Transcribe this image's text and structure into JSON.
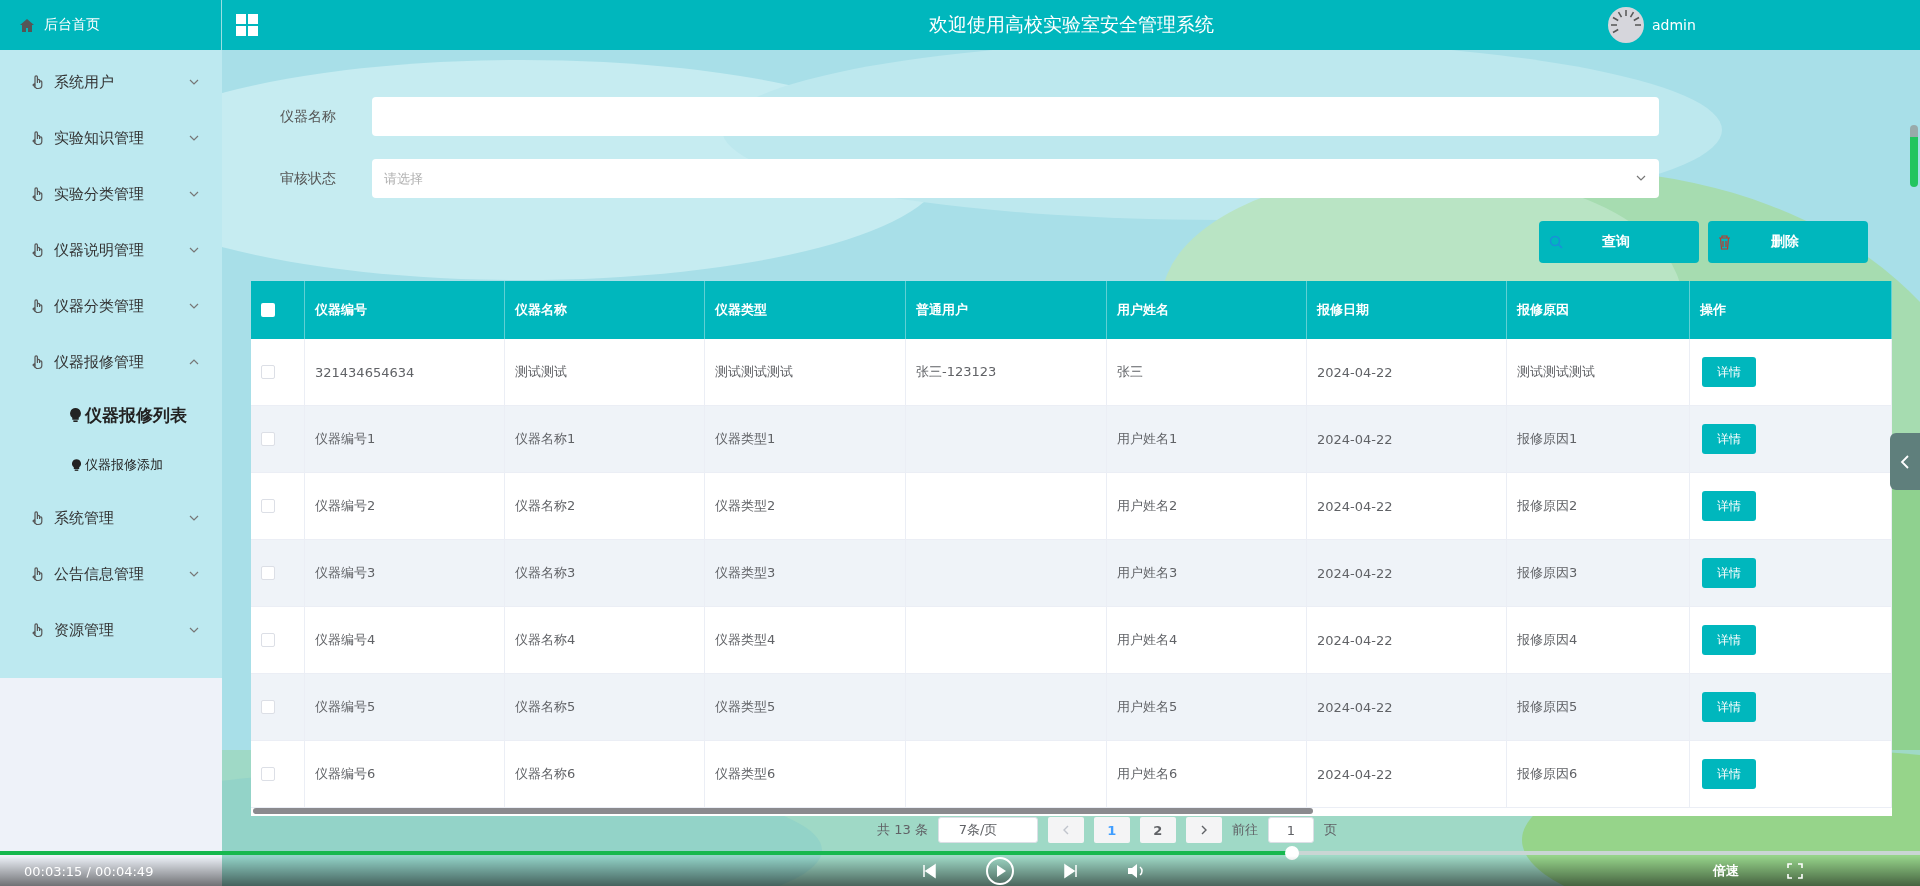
{
  "header": {
    "title": "欢迎使用高校实验室安全管理系统",
    "user": "admin"
  },
  "sidebar": {
    "home": "后台首页",
    "items": [
      {
        "label": "系统用户",
        "expanded": false
      },
      {
        "label": "实验知识管理",
        "expanded": false
      },
      {
        "label": "实验分类管理",
        "expanded": false
      },
      {
        "label": "仪器说明管理",
        "expanded": false
      },
      {
        "label": "仪器分类管理",
        "expanded": false
      },
      {
        "label": "仪器报修管理",
        "expanded": true,
        "children": [
          {
            "label": "仪器报修列表",
            "selected": true
          },
          {
            "label": "仪器报修添加",
            "selected": false
          }
        ]
      },
      {
        "label": "系统管理",
        "expanded": false
      },
      {
        "label": "公告信息管理",
        "expanded": false
      },
      {
        "label": "资源管理",
        "expanded": false
      }
    ]
  },
  "search": {
    "fields": [
      {
        "label": "仪器名称",
        "kind": "input"
      },
      {
        "label": "审核状态",
        "kind": "select",
        "placeholder": "请选择"
      }
    ],
    "buttons": [
      {
        "label": "查询",
        "kind": "search"
      },
      {
        "label": "删除",
        "kind": "delete"
      }
    ]
  },
  "table": {
    "select_all_checked": false,
    "columns": [
      "仪器编号",
      "仪器名称",
      "仪器类型",
      "普通用户",
      "用户姓名",
      "报修日期",
      "报修原因",
      "操作"
    ],
    "rows": [
      {
        "checked": false,
        "cells": [
          "321434654634",
          "测试测试",
          "测试测试测试",
          "张三-123123",
          "张三",
          "2024-04-22",
          "测试测试测试"
        ],
        "action": "详情"
      },
      {
        "checked": false,
        "cells": [
          "仪器编号1",
          "仪器名称1",
          "仪器类型1",
          null,
          "用户姓名1",
          "2024-04-22",
          "报修原因1"
        ],
        "action": "详情"
      },
      {
        "checked": false,
        "cells": [
          "仪器编号2",
          "仪器名称2",
          "仪器类型2",
          null,
          "用户姓名2",
          "2024-04-22",
          "报修原因2"
        ],
        "action": "详情"
      },
      {
        "checked": false,
        "cells": [
          "仪器编号3",
          "仪器名称3",
          "仪器类型3",
          null,
          "用户姓名3",
          "2024-04-22",
          "报修原因3"
        ],
        "action": "详情"
      },
      {
        "checked": false,
        "cells": [
          "仪器编号4",
          "仪器名称4",
          "仪器类型4",
          null,
          "用户姓名4",
          "2024-04-22",
          "报修原因4"
        ],
        "action": "详情"
      },
      {
        "checked": false,
        "cells": [
          "仪器编号5",
          "仪器名称5",
          "仪器类型5",
          null,
          "用户姓名5",
          "2024-04-22",
          "报修原因5"
        ],
        "action": "详情"
      },
      {
        "checked": false,
        "cells": [
          "仪器编号6",
          "仪器名称6",
          "仪器类型6",
          null,
          "用户姓名6",
          "2024-04-22",
          "报修原因6"
        ],
        "action": "详情"
      }
    ]
  },
  "pagination": {
    "total": "共 13 条",
    "page_size": "7条/页",
    "pages": [
      {
        "label": "1",
        "selected": true
      },
      {
        "label": "2",
        "selected": false
      }
    ],
    "goto_label": "前往",
    "goto_value": "1",
    "page_suffix": "页"
  },
  "player": {
    "time": "00:03:15 / 00:04:49",
    "level": 0.673,
    "speed": "倍速"
  }
}
